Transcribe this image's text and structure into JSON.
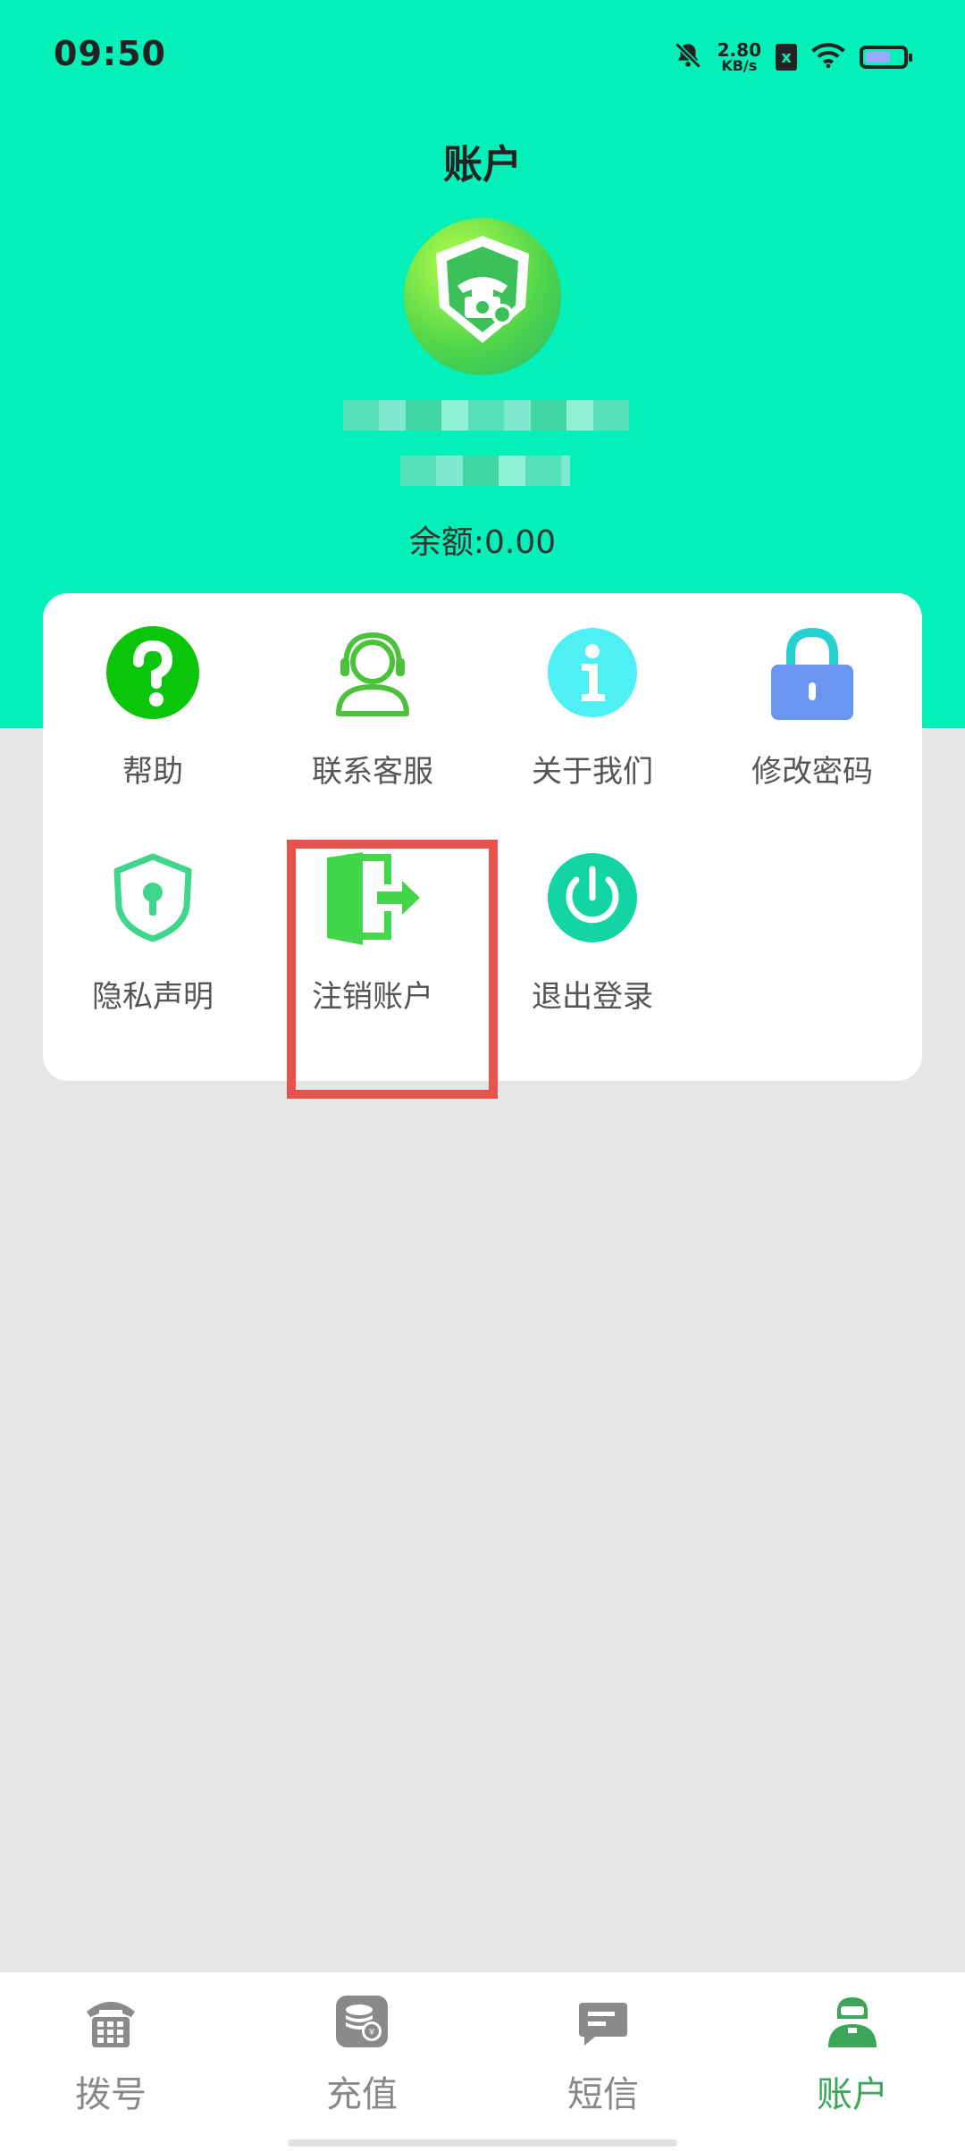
{
  "status_bar": {
    "time": "09:50",
    "net_speed_value": "2.80",
    "net_speed_unit": "KB/s",
    "sim_badge": "x",
    "battery_level": 0.7,
    "icons": [
      "bell-off-icon",
      "sim-x-icon",
      "wifi-icon",
      "battery-icon"
    ]
  },
  "header": {
    "title": "账户",
    "balance_label": "余额:",
    "balance_value": "0.00"
  },
  "menu": {
    "items": [
      {
        "label": "帮助",
        "icon": "help-icon"
      },
      {
        "label": "联系客服",
        "icon": "customer-service-icon"
      },
      {
        "label": "关于我们",
        "icon": "info-icon"
      },
      {
        "label": "修改密码",
        "icon": "lock-icon"
      },
      {
        "label": "隐私声明",
        "icon": "privacy-shield-icon"
      },
      {
        "label": "注销账户",
        "icon": "exit-door-icon"
      },
      {
        "label": "退出登录",
        "icon": "power-icon"
      }
    ]
  },
  "bottom_nav": {
    "items": [
      {
        "label": "拨号",
        "icon": "dial-phone-icon"
      },
      {
        "label": "充值",
        "icon": "recharge-coins-icon"
      },
      {
        "label": "短信",
        "icon": "sms-icon"
      },
      {
        "label": "账户",
        "icon": "account-icon"
      }
    ],
    "active": "账户"
  },
  "colors": {
    "header_bg": "#03f0b8",
    "active_nav": "#3ba65a",
    "highlight": "#e8524c"
  }
}
